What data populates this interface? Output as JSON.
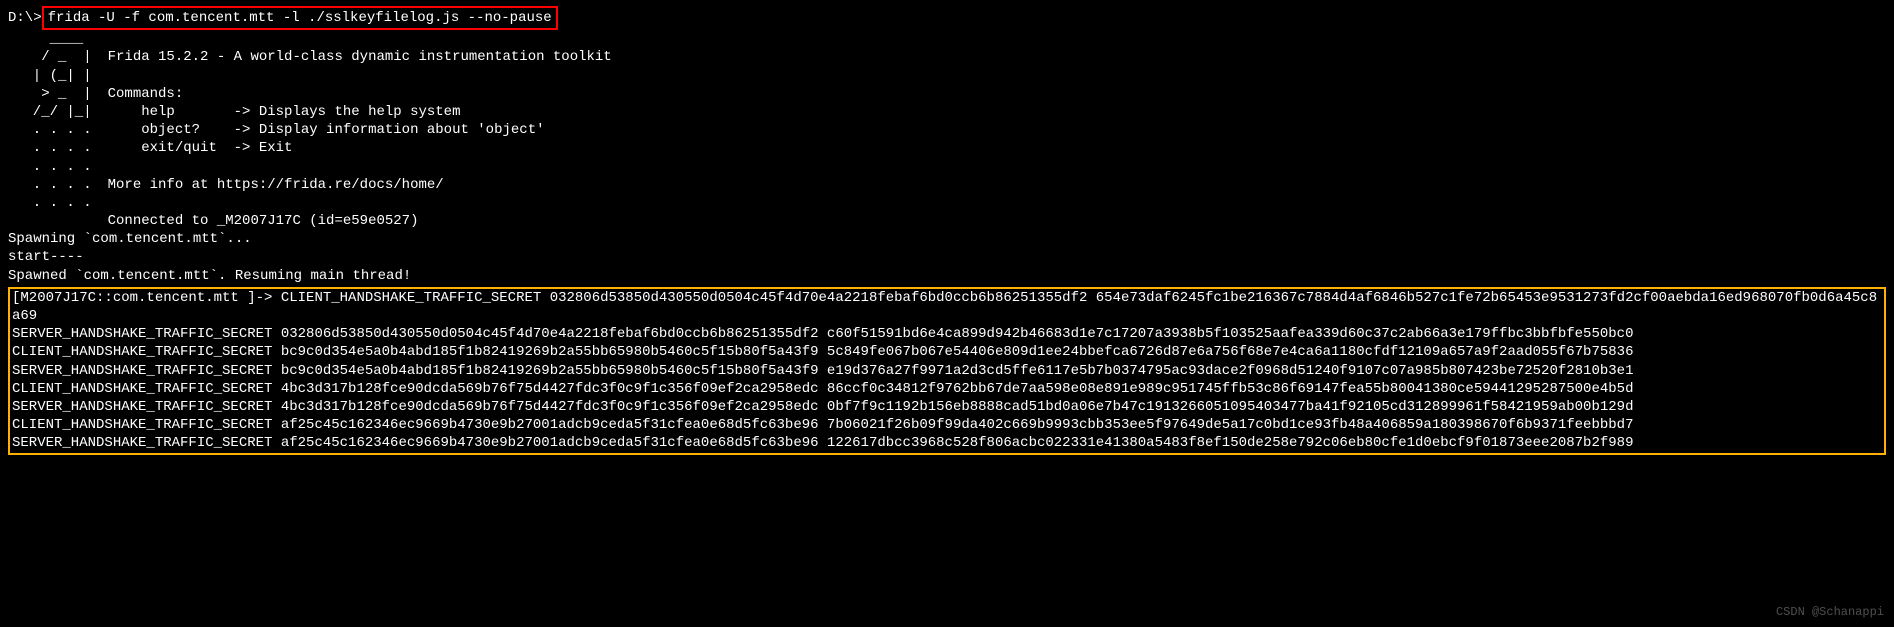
{
  "prompt": "D:\\>",
  "command": "frida -U -f com.tencent.mtt -l ./sslkeyfilelog.js --no-pause",
  "ascii_art": "    ____\n   / _  |\n  | (_| |\n   > _  |\n  /_/ |_|\n  . . . .\n  . . . .\n  . . . .\n  . . . .\n  . . . .",
  "version_line": "Frida 15.2.2 - A world-class dynamic instrumentation toolkit",
  "commands_header": "Commands:",
  "cmd_help": "    help       -> Displays the help system",
  "cmd_object": "    object?    -> Display information about 'object'",
  "cmd_exit": "    exit/quit  -> Exit",
  "more_info": "More info at https://frida.re/docs/home/",
  "connected": "Connected to _M2007J17C (id=e59e0527)",
  "spawning": "Spawning `com.tencent.mtt`...",
  "start": "start----",
  "spawned": "Spawned `com.tencent.mtt`. Resuming main thread!",
  "target_prompt": "[M2007J17C::com.tencent.mtt ]-> ",
  "secrets": [
    "CLIENT_HANDSHAKE_TRAFFIC_SECRET 032806d53850d430550d0504c45f4d70e4a2218febaf6bd0ccb6b86251355df2 654e73daf6245fc1be216367c7884d4af6846b527c1fe72b65453e9531273fd2cf00aebda16ed968070fb0d6a45c8a69",
    "SERVER_HANDSHAKE_TRAFFIC_SECRET 032806d53850d430550d0504c45f4d70e4a2218febaf6bd0ccb6b86251355df2 c60f51591bd6e4ca899d942b46683d1e7c17207a3938b5f103525aafea339d60c37c2ab66a3e179ffbc3bbfbfe550bc0",
    "CLIENT_HANDSHAKE_TRAFFIC_SECRET bc9c0d354e5a0b4abd185f1b82419269b2a55bb65980b5460c5f15b80f5a43f9 5c849fe067b067e54406e809d1ee24bbefca6726d87e6a756f68e7e4ca6a1180cfdf12109a657a9f2aad055f67b75836",
    "SERVER_HANDSHAKE_TRAFFIC_SECRET bc9c0d354e5a0b4abd185f1b82419269b2a55bb65980b5460c5f15b80f5a43f9 e19d376a27f9971a2d3cd5ffe6117e5b7b0374795ac93dace2f0968d51240f9107c07a985b807423be72520f2810b3e1",
    "CLIENT_HANDSHAKE_TRAFFIC_SECRET 4bc3d317b128fce90dcda569b76f75d4427fdc3f0c9f1c356f09ef2ca2958edc 86ccf0c34812f9762bb67de7aa598e08e891e989c951745ffb53c86f69147fea55b80041380ce59441295287500e4b5d",
    "SERVER_HANDSHAKE_TRAFFIC_SECRET 4bc3d317b128fce90dcda569b76f75d4427fdc3f0c9f1c356f09ef2ca2958edc 0bf7f9c1192b156eb8888cad51bd0a06e7b47c1913266051095403477ba41f92105cd312899961f58421959ab00b129d",
    "CLIENT_HANDSHAKE_TRAFFIC_SECRET af25c45c162346ec9669b4730e9b27001adcb9ceda5f31cfea0e68d5fc63be96 7b06021f26b09f99da402c669b9993cbb353ee5f97649de5a17c0bd1ce93fb48a406859a180398670f6b9371feebbbd7",
    "SERVER_HANDSHAKE_TRAFFIC_SECRET af25c45c162346ec9669b4730e9b27001adcb9ceda5f31cfea0e68d5fc63be96 122617dbcc3968c528f806acbc022331e41380a5483f8ef150de258e792c06eb80cfe1d0ebcf9f01873eee2087b2f989"
  ],
  "watermark": "CSDN @Schanappi"
}
